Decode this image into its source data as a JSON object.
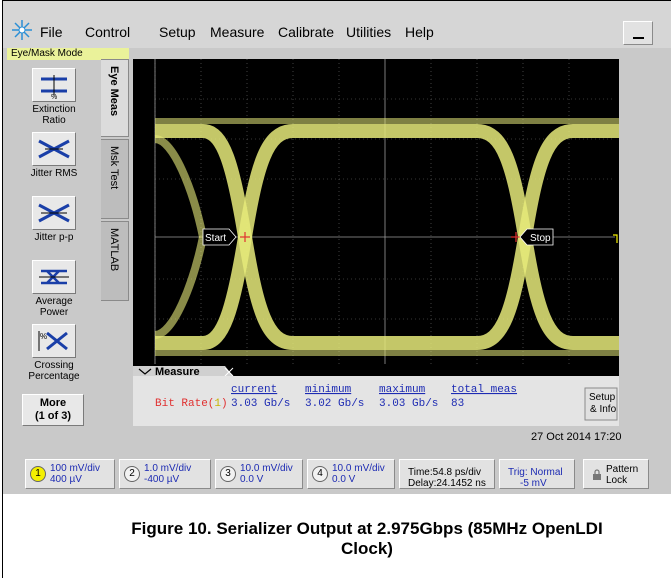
{
  "menu": {
    "items": [
      "File",
      "Control",
      "Setup",
      "Measure",
      "Calibrate",
      "Utilities",
      "Help"
    ],
    "minimize_label": ""
  },
  "mode_label": "Eye/Mask Mode",
  "tools": [
    {
      "label": "Extinction\nRatio"
    },
    {
      "label": "Jitter RMS"
    },
    {
      "label": "Jitter p-p"
    },
    {
      "label": "Average\nPower"
    },
    {
      "label": "Crossing\nPercentage"
    }
  ],
  "more_button": {
    "line1": "More",
    "line2": "(1 of 3)"
  },
  "tabs": [
    "Eye Meas",
    "Msk Test",
    "MATLAB"
  ],
  "markers": {
    "start": "Start",
    "stop": "Stop"
  },
  "measure": {
    "title": "Measure",
    "headers": [
      "current",
      "minimum",
      "maximum",
      "total meas"
    ],
    "row_label": "Bit Rate(",
    "row_channel": "1",
    "row_label_end": ")",
    "values": [
      "3.03 Gb/s",
      "3.02 Gb/s",
      "3.03 Gb/s",
      "83"
    ],
    "setup_info": {
      "line1": "Setup",
      "line2": "& Info"
    }
  },
  "datetime": "27 Oct 2014  17:20",
  "channels": [
    {
      "num": "1",
      "line1": "100 mV/div",
      "line2": "400 µV"
    },
    {
      "num": "2",
      "line1": "1.0 mV/div",
      "line2": "-400 µV"
    },
    {
      "num": "3",
      "line1": "10.0 mV/div",
      "line2": "0.0 V"
    },
    {
      "num": "4",
      "line1": "10.0 mV/div",
      "line2": "0.0 V"
    }
  ],
  "timebase": {
    "line1": "Time:54.8 ps/div",
    "line2": "Delay:24.1452 ns"
  },
  "trigger": {
    "line1": "Trig: Normal",
    "line2": "-5 mV"
  },
  "pattern_lock": {
    "line1": "Pattern",
    "line2": "Lock"
  },
  "caption": {
    "line1": "Figure 10. Serializer Output at 2.975Gbps (85MHz OpenLDI",
    "line2": "Clock)"
  },
  "colors": {
    "trace": "#e6ea7a",
    "mode_label_bg": "#eaf29a",
    "channel_text": "#1d2bb3",
    "rate_label": "#e03030"
  }
}
